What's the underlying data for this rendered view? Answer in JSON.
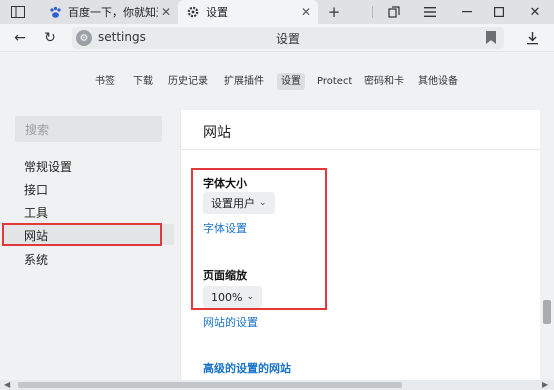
{
  "tabs": [
    {
      "label": "百度一下，你就知道",
      "icon": "baidu-paw-icon"
    },
    {
      "label": "设置",
      "icon": "gear-icon"
    }
  ],
  "address": {
    "url": "settings",
    "page_title": "设置"
  },
  "settings_nav": [
    "书签",
    "下载",
    "历史记录",
    "扩展插件",
    "设置",
    "Protect",
    "密码和卡",
    "其他设备"
  ],
  "settings_nav_active": "设置",
  "sidebar": {
    "search_placeholder": "搜索",
    "items": [
      "常规设置",
      "接口",
      "工具",
      "网站",
      "系统"
    ],
    "selected": "网站"
  },
  "main": {
    "heading": "网站",
    "font_size": {
      "title": "字体大小",
      "value": "设置用户",
      "link": "字体设置"
    },
    "zoom": {
      "title": "页面缩放",
      "value": "100%"
    },
    "site_settings_link": "网站的设置",
    "advanced_link": "高级的设置的网站"
  },
  "colors": {
    "highlight": "#e2393d",
    "link": "#1a73c8"
  }
}
